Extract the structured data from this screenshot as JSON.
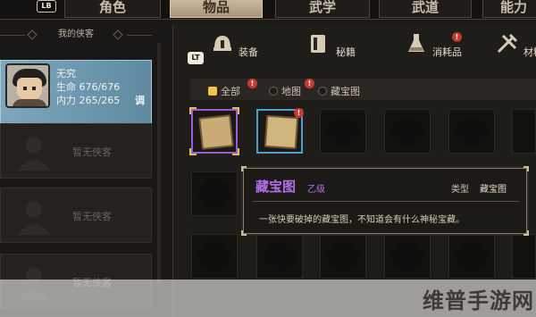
{
  "top_tabs": {
    "lb_label": "LB",
    "tabs": [
      {
        "label": "角色"
      },
      {
        "label": "物品"
      },
      {
        "label": "武学"
      },
      {
        "label": "武道"
      },
      {
        "label": "能力"
      }
    ]
  },
  "left": {
    "header": "我的侠客",
    "hero": {
      "name": "无究",
      "hp": "生命 676/676",
      "mp": "内力 265/265",
      "tune": "调"
    },
    "empty_label": "暂无侠客"
  },
  "inventory": {
    "lt_label": "LT",
    "categories": [
      {
        "label": "装备",
        "icon": "helmet-icon",
        "badge": ""
      },
      {
        "label": "秘籍",
        "icon": "book-icon",
        "badge": ""
      },
      {
        "label": "消耗品",
        "icon": "potion-flask-icon",
        "badge": "!"
      },
      {
        "label": "材料",
        "icon": "crafting-tools-icon",
        "badge": ""
      }
    ],
    "filters": [
      {
        "label": "全部",
        "badge": "!"
      },
      {
        "label": "地图",
        "badge": "!"
      },
      {
        "label": "藏宝图",
        "badge": ""
      }
    ],
    "item_badge": "!"
  },
  "tooltip": {
    "title": "藏宝图",
    "grade": "乙级",
    "type_label": "类型",
    "type_value": "藏宝图",
    "description": "一张快要破掉的藏宝图，不知道会有什么神秘宝藏。"
  },
  "watermark": "维普手游网",
  "colors": {
    "active_tab": "#b8a587",
    "hero_card": "#6f98ae",
    "rarity_purple": "#9b5cd8",
    "rarity_blue": "#4a9fd0",
    "tooltip_title": "#b56ee8",
    "badge_red": "#c8382c",
    "filter_on": "#f0c54a"
  }
}
